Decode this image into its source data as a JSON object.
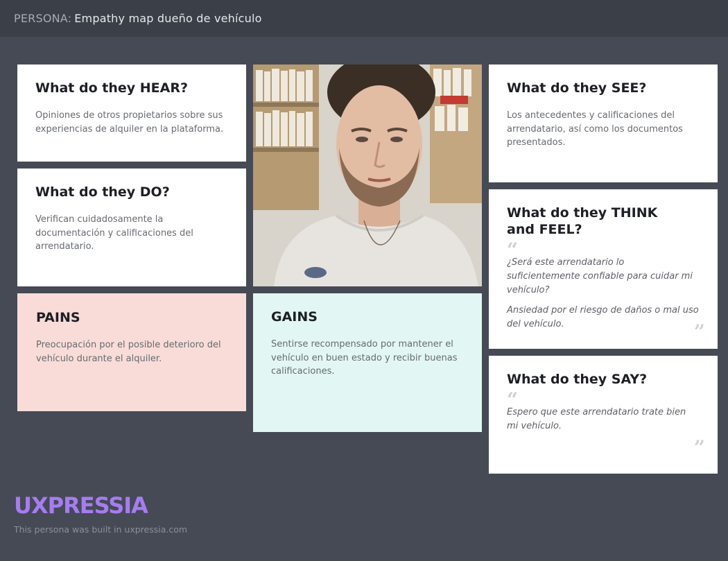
{
  "header": {
    "prefix": "PERSONA:",
    "title": "Empathy map dueño de vehículo"
  },
  "cards": {
    "hear": {
      "title": "What do they HEAR?",
      "body": "Opiniones de otros propietarios sobre sus experiencias de alquiler en la plataforma."
    },
    "do": {
      "title": "What do they DO?",
      "body": "Verifican cuidadosamente la documentación y calificaciones del arrendatario."
    },
    "see": {
      "title": "What do they SEE?",
      "body": "Los antecedentes y calificaciones del arrendatario, así como los documentos presentados."
    },
    "think_feel": {
      "title_line1": "What do they THINK",
      "title_line2": "and FEEL?",
      "quotes": [
        "¿Será este arrendatario lo suficientemente confiable para cuidar mi vehículo?",
        "Ansiedad por el riesgo de daños o mal uso del vehículo."
      ]
    },
    "say": {
      "title": "What do they SAY?",
      "quote": "Espero que este arrendatario trate bien mi vehículo."
    },
    "pains": {
      "title": "PAINS",
      "body": "Preocupación por el posible deterioro del vehículo durante el alquiler."
    },
    "gains": {
      "title": "GAINS",
      "body": "Sentirse recompensado por mantener el vehículo en buen estado y recibir buenas calificaciones."
    }
  },
  "quote_marks": {
    "open": "“",
    "close": "”"
  },
  "footer": {
    "logo": "UXPRESSIA",
    "note": "This persona was built in uxpressia.com"
  },
  "colors": {
    "background": "#454a54",
    "topbar": "#3b3f47",
    "pains": "#f9dcd8",
    "gains": "#e2f7f3",
    "logo": "#a77cf2"
  }
}
